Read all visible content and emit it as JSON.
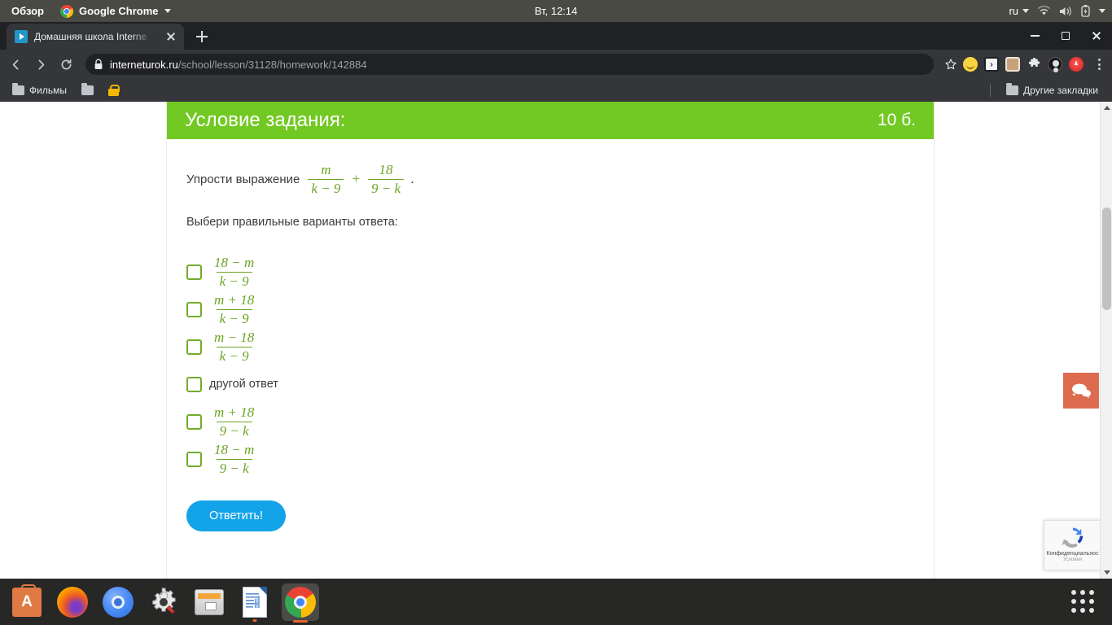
{
  "os_bar": {
    "overview_label": "Обзор",
    "app_menu_label": "Google Chrome",
    "clock": "Вт, 12:14",
    "keyboard_layout": "ru",
    "icons": [
      "wifi-icon",
      "volume-icon",
      "battery-icon"
    ]
  },
  "browser": {
    "tab": {
      "title": "Домашняя школа Interne",
      "favicon_name": "interneturok-favicon"
    },
    "new_tab_tooltip": "Новая вкладка",
    "omnibox": {
      "host": "interneturok.ru",
      "path": "/school/lesson/31128/homework/142884",
      "security_icon": "lock-icon"
    },
    "extensions": [
      "smiley-extension-icon",
      "dark-square-extension-icon",
      "camera-extension-icon",
      "puzzle-extension-icon",
      "profile-avatar-icon",
      "red-badge-extension-icon"
    ],
    "bookmarks": {
      "items": [
        {
          "label": "Фильмы",
          "icon": "folder-icon"
        },
        {
          "label": "",
          "icon": "folder-icon"
        },
        {
          "label": "",
          "icon": "lock-icon"
        }
      ],
      "other_bookmarks_label": "Другие закладки"
    }
  },
  "page": {
    "header": {
      "title": "Условие задания:",
      "score": "10 б."
    },
    "question": {
      "prefix": "Упрости выражение",
      "expr": {
        "frac1": {
          "num": "m",
          "den": "k − 9"
        },
        "operator": "+",
        "frac2": {
          "num": "18",
          "den": "9 − k"
        }
      },
      "suffix": "."
    },
    "instruction": "Выбери правильные варианты ответа:",
    "options": [
      {
        "type": "fraction",
        "num": "18 − m",
        "den": "k − 9",
        "checked": false
      },
      {
        "type": "fraction",
        "num": "m + 18",
        "den": "k − 9",
        "checked": false
      },
      {
        "type": "fraction",
        "num": "m − 18",
        "den": "k − 9",
        "checked": false
      },
      {
        "type": "text",
        "label": "другой ответ",
        "checked": false
      },
      {
        "type": "fraction",
        "num": "m + 18",
        "den": "9 − k",
        "checked": false
      },
      {
        "type": "fraction",
        "num": "18 − m",
        "den": "9 − k",
        "checked": false
      }
    ],
    "submit_label": "Ответить!",
    "chat_widget": {
      "icon": "chat-bubbles-icon"
    },
    "recaptcha": {
      "line1": "Конфиденциальнос",
      "line2": "Условия"
    },
    "colors": {
      "header_green": "#73c923",
      "math_green": "#6aa524",
      "checkbox_green": "#74ac2c",
      "submit_blue": "#13a3e8",
      "chat_orange": "#dd6b4f"
    }
  },
  "dock": {
    "items": [
      "ubuntu-software-icon",
      "firefox-icon",
      "chromium-icon",
      "settings-icon",
      "files-icon",
      "libreoffice-writer-icon",
      "google-chrome-icon"
    ],
    "show_apps_label": "show-applications-icon"
  }
}
